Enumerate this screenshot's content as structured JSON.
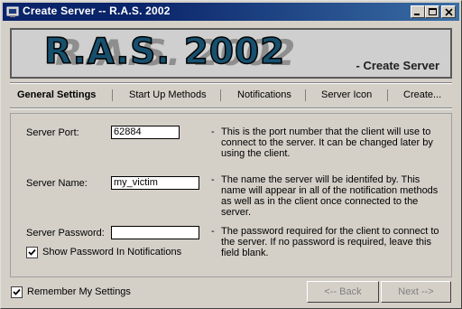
{
  "window": {
    "title": "Create Server -- R.A.S. 2002"
  },
  "banner": {
    "logo": "R.A.S. 2002",
    "subtitle": "- Create Server"
  },
  "tabs": [
    {
      "label": "General Settings",
      "active": true
    },
    {
      "label": "Start Up Methods",
      "active": false
    },
    {
      "label": "Notifications",
      "active": false
    },
    {
      "label": "Server Icon",
      "active": false
    },
    {
      "label": "Create...",
      "active": false
    }
  ],
  "fields": {
    "port": {
      "label": "Server Port:",
      "value": "62884",
      "description": "This is the port number that the client will use to connect to the server. It can be changed later by using the client."
    },
    "name": {
      "label": "Server Name:",
      "value": "my_victim",
      "description": "The name the server will be identifed by. This name will appear in all of the notification methods as well as in the client once connected to the server."
    },
    "password": {
      "label": "Server Password:",
      "value": "",
      "description": "The password required for the client to connect to the server. If no password is required, leave this field blank."
    }
  },
  "show_password_checkbox": {
    "label": "Show Password In Notifications",
    "checked": true
  },
  "remember_checkbox": {
    "label": "Remember My Settings",
    "checked": true
  },
  "buttons": {
    "back": "<-- Back",
    "next": "Next -->"
  },
  "description_dash": "-",
  "colors": {
    "titlebar": "#0a246a",
    "logo": "#17506e",
    "face": "#d4d0c8"
  }
}
